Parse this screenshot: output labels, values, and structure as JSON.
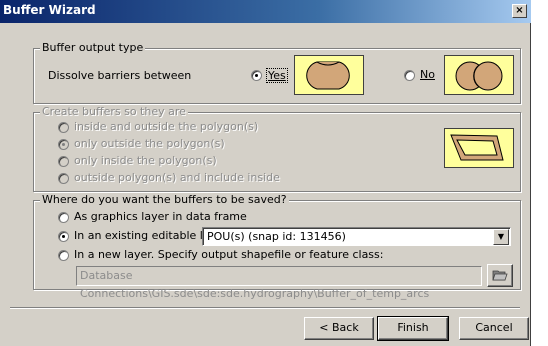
{
  "window": {
    "title": "Buffer Wizard",
    "close_glyph": "×"
  },
  "buffer_output": {
    "legend": "Buffer output type",
    "dissolve_label": "Dissolve barriers between",
    "yes_label": "Yes",
    "no_label": "No",
    "selected": "yes"
  },
  "create_buffers": {
    "legend": "Create buffers so they are",
    "options": [
      {
        "label": "inside and outside the polygon(s)",
        "selected": false
      },
      {
        "label": "only outside the polygon(s)",
        "selected": true
      },
      {
        "label": "only inside the polygon(s)",
        "selected": false
      },
      {
        "label": "outside polygon(s) and include inside",
        "selected": false
      }
    ]
  },
  "save": {
    "legend": "Where do you want the buffers to be saved?",
    "options": [
      {
        "label": "As graphics layer in data frame",
        "selected": false
      },
      {
        "label": "In an existing editable layer",
        "selected": true
      },
      {
        "label": "In a new layer.  Specify output shapefile or feature class:",
        "selected": false
      }
    ],
    "layer_value": "POU(s) (snap id:  131456)",
    "output_path": "Database Connections\\GIS.sde\\sde:sde.hydrography\\Buffer_of_temp_arcs"
  },
  "buttons": {
    "back": "< Back",
    "finish": "Finish",
    "cancel": "Cancel"
  },
  "colors": {
    "title_start": "#0a246a",
    "title_end": "#a6caf0",
    "preview_bg": "#ffff9c",
    "shape_fill": "#d2a679"
  }
}
